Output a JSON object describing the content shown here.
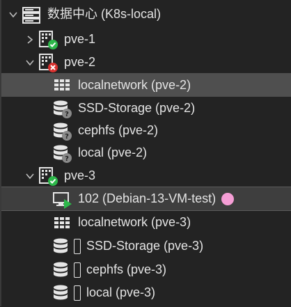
{
  "colors": {
    "background": "#232323",
    "selected_row": "#4f4f4f",
    "selected_row_dark": "#3e3e3e",
    "text": "#e4e4e4",
    "status_ok": "#2db84a",
    "status_error": "#d9312f",
    "status_unknown": "#8a8a8a",
    "vm_running": "#2db84a",
    "tag_dot": "#f59ed5"
  },
  "tree": {
    "datacenter": {
      "label": "数据中心 (K8s-local)",
      "icon": "server-rack-icon",
      "expanded": true
    },
    "nodes": [
      {
        "label": "pve-1",
        "icon": "node-server-icon",
        "status": "online",
        "expanded": false
      },
      {
        "label": "pve-2",
        "icon": "node-server-icon",
        "status": "offline",
        "expanded": true,
        "children": [
          {
            "label": "localnetwork (pve-2)",
            "icon": "network-grid-icon",
            "status": "none",
            "selected": true
          },
          {
            "label": "SSD-Storage (pve-2)",
            "icon": "storage-database-icon",
            "status": "unknown"
          },
          {
            "label": "cephfs (pve-2)",
            "icon": "storage-database-icon",
            "status": "unknown"
          },
          {
            "label": "local (pve-2)",
            "icon": "storage-database-icon",
            "status": "unknown"
          }
        ]
      },
      {
        "label": "pve-3",
        "icon": "node-server-icon",
        "status": "online",
        "expanded": true,
        "children": [
          {
            "label": "102 (Debian-13-VM-test)",
            "icon": "vm-running-icon",
            "status": "running",
            "highlighted": true,
            "tag": "tag-dot"
          },
          {
            "label": "localnetwork (pve-3)",
            "icon": "network-grid-icon",
            "status": "none"
          },
          {
            "label": "SSD-Storage (pve-3)",
            "icon": "storage-database-icon",
            "status": "available"
          },
          {
            "label": "cephfs (pve-3)",
            "icon": "storage-database-icon",
            "status": "available"
          },
          {
            "label": "local (pve-3)",
            "icon": "storage-database-icon",
            "status": "available"
          }
        ]
      }
    ]
  }
}
